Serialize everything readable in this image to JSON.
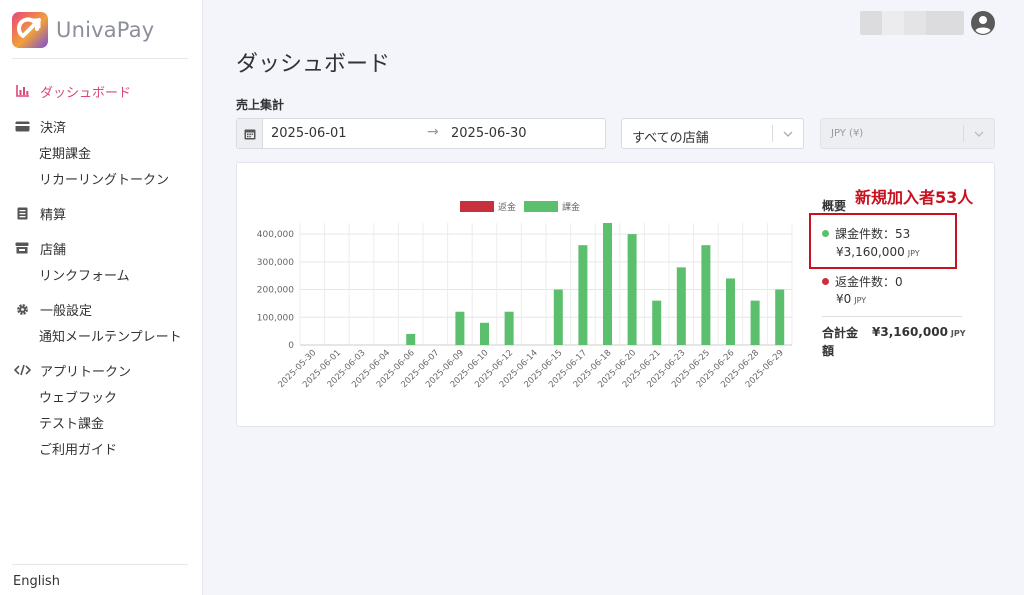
{
  "app": {
    "brand": "UnivaPay"
  },
  "sidebar": {
    "items": [
      {
        "label": "ダッシュボード",
        "icon": "bar-chart-icon",
        "active": true,
        "subs": []
      },
      {
        "label": "決済",
        "icon": "credit-card-icon",
        "subs": [
          "定期課金",
          "リカーリングトークン"
        ]
      },
      {
        "label": "精算",
        "icon": "document-icon",
        "subs": []
      },
      {
        "label": "店舗",
        "icon": "store-icon",
        "subs": [
          "リンクフォーム"
        ]
      },
      {
        "label": "一般設定",
        "icon": "gear-icon",
        "subs": [
          "通知メールテンプレート"
        ]
      },
      {
        "label": "アプリトークン",
        "icon": "code-icon",
        "subs": [
          "ウェブフック",
          "テスト課金",
          "ご利用ガイド"
        ]
      }
    ],
    "language": "English"
  },
  "page": {
    "title": "ダッシュボード",
    "section": "売上集計"
  },
  "filters": {
    "date_start": "2025-06-01",
    "date_end": "2025-06-30",
    "store": "すべての店舗",
    "currency": "JPY (¥)"
  },
  "summary": {
    "title": "概要",
    "annotation": "新規加入者53人",
    "charges_label": "課金件数：53",
    "charges_amount": "¥3,160,000",
    "refunds_label": "返金件数：0",
    "refunds_amount": "¥0",
    "currency_code": "JPY",
    "total_label": "合計金額",
    "total_value": "¥3,160,000"
  },
  "colors": {
    "charge": "#5cbf6e",
    "refund": "#c9303e",
    "accent": "#d9487a",
    "annotation": "#c8101f"
  },
  "chart_data": {
    "type": "bar",
    "categories": [
      "2025-05-30",
      "2025-06-01",
      "2025-06-03",
      "2025-06-04",
      "2025-06-06",
      "2025-06-07",
      "2025-06-09",
      "2025-06-10",
      "2025-06-12",
      "2025-06-14",
      "2025-06-15",
      "2025-06-17",
      "2025-06-18",
      "2025-06-20",
      "2025-06-21",
      "2025-06-23",
      "2025-06-25",
      "2025-06-26",
      "2025-06-28",
      "2025-06-29"
    ],
    "series": [
      {
        "name": "返金",
        "values": [
          0,
          0,
          0,
          0,
          0,
          0,
          0,
          0,
          0,
          0,
          0,
          0,
          0,
          0,
          0,
          0,
          0,
          0,
          0,
          0
        ]
      },
      {
        "name": "課金",
        "values": [
          0,
          0,
          0,
          0,
          40000,
          0,
          120000,
          80000,
          120000,
          0,
          200000,
          360000,
          440000,
          400000,
          160000,
          280000,
          360000,
          240000,
          160000,
          200000
        ]
      }
    ],
    "ylim": [
      0,
      440000
    ],
    "yticks": [
      0,
      100000,
      200000,
      300000,
      400000
    ],
    "ytick_labels": [
      "0",
      "100,000",
      "200,000",
      "300,000",
      "400,000"
    ],
    "grid": true,
    "legend": "top"
  }
}
